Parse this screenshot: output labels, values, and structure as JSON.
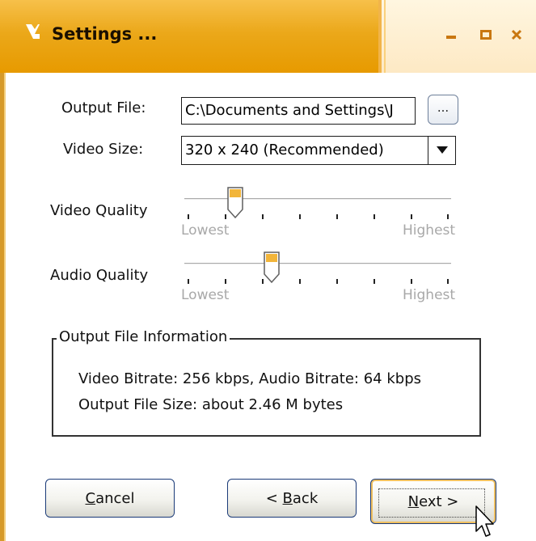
{
  "window": {
    "title": "Settings ..."
  },
  "form": {
    "output_file_label": "Output File:",
    "output_file_value": "C:\\Documents and Settings\\J",
    "browse_label": "...",
    "video_size_label": "Video Size:",
    "video_size_value": "320 x 240 (Recommended)"
  },
  "sliders": {
    "video": {
      "label": "Video Quality",
      "min_label": "Lowest",
      "max_label": "Highest",
      "level": 0.17
    },
    "audio": {
      "label": "Audio Quality",
      "min_label": "Lowest",
      "max_label": "Highest",
      "level": 0.33
    }
  },
  "info_group": {
    "title": "Output File Information",
    "line1": "Video Bitrate: 256 kbps, Audio Bitrate: 64 kbps",
    "line2": "Output File Size: about 2.46 M bytes"
  },
  "buttons": {
    "cancel_rest": "ancel",
    "cancel_key": "C",
    "back_prefix": "< ",
    "back_key": "B",
    "back_rest": "ack",
    "next_key": "N",
    "next_rest": "ext >"
  },
  "icons": {
    "app": "arrow-icon",
    "minimize": "minimize-icon",
    "maximize": "maximize-icon",
    "close": "close-icon",
    "dropdown": "triangle-down-icon",
    "cursor": "mouse-pointer-icon"
  },
  "colors": {
    "title_accent": "#e79a00",
    "slider_thumb": "#f2b53a"
  }
}
